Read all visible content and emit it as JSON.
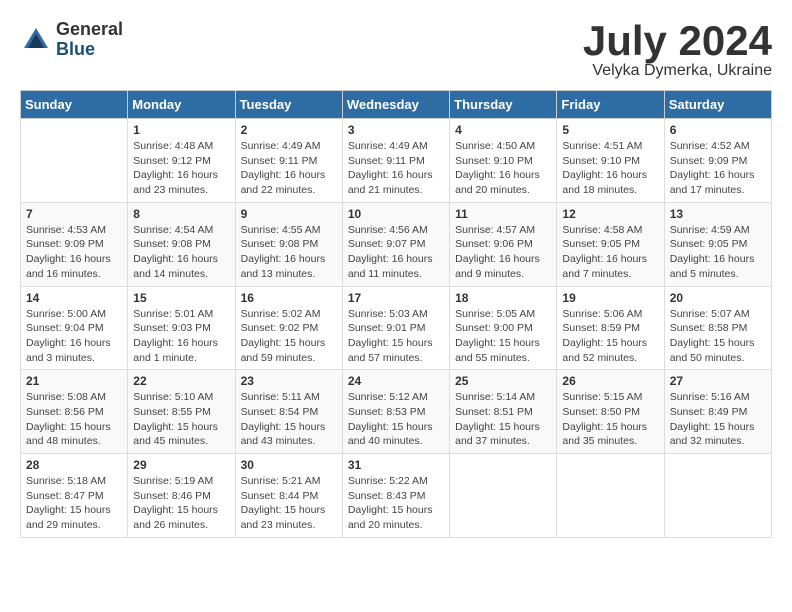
{
  "header": {
    "logo_general": "General",
    "logo_blue": "Blue",
    "title": "July 2024",
    "location": "Velyka Dymerka, Ukraine"
  },
  "columns": [
    "Sunday",
    "Monday",
    "Tuesday",
    "Wednesday",
    "Thursday",
    "Friday",
    "Saturday"
  ],
  "weeks": [
    [
      {
        "day": "",
        "info": ""
      },
      {
        "day": "1",
        "info": "Sunrise: 4:48 AM\nSunset: 9:12 PM\nDaylight: 16 hours\nand 23 minutes."
      },
      {
        "day": "2",
        "info": "Sunrise: 4:49 AM\nSunset: 9:11 PM\nDaylight: 16 hours\nand 22 minutes."
      },
      {
        "day": "3",
        "info": "Sunrise: 4:49 AM\nSunset: 9:11 PM\nDaylight: 16 hours\nand 21 minutes."
      },
      {
        "day": "4",
        "info": "Sunrise: 4:50 AM\nSunset: 9:10 PM\nDaylight: 16 hours\nand 20 minutes."
      },
      {
        "day": "5",
        "info": "Sunrise: 4:51 AM\nSunset: 9:10 PM\nDaylight: 16 hours\nand 18 minutes."
      },
      {
        "day": "6",
        "info": "Sunrise: 4:52 AM\nSunset: 9:09 PM\nDaylight: 16 hours\nand 17 minutes."
      }
    ],
    [
      {
        "day": "7",
        "info": "Sunrise: 4:53 AM\nSunset: 9:09 PM\nDaylight: 16 hours\nand 16 minutes."
      },
      {
        "day": "8",
        "info": "Sunrise: 4:54 AM\nSunset: 9:08 PM\nDaylight: 16 hours\nand 14 minutes."
      },
      {
        "day": "9",
        "info": "Sunrise: 4:55 AM\nSunset: 9:08 PM\nDaylight: 16 hours\nand 13 minutes."
      },
      {
        "day": "10",
        "info": "Sunrise: 4:56 AM\nSunset: 9:07 PM\nDaylight: 16 hours\nand 11 minutes."
      },
      {
        "day": "11",
        "info": "Sunrise: 4:57 AM\nSunset: 9:06 PM\nDaylight: 16 hours\nand 9 minutes."
      },
      {
        "day": "12",
        "info": "Sunrise: 4:58 AM\nSunset: 9:05 PM\nDaylight: 16 hours\nand 7 minutes."
      },
      {
        "day": "13",
        "info": "Sunrise: 4:59 AM\nSunset: 9:05 PM\nDaylight: 16 hours\nand 5 minutes."
      }
    ],
    [
      {
        "day": "14",
        "info": "Sunrise: 5:00 AM\nSunset: 9:04 PM\nDaylight: 16 hours\nand 3 minutes."
      },
      {
        "day": "15",
        "info": "Sunrise: 5:01 AM\nSunset: 9:03 PM\nDaylight: 16 hours\nand 1 minute."
      },
      {
        "day": "16",
        "info": "Sunrise: 5:02 AM\nSunset: 9:02 PM\nDaylight: 15 hours\nand 59 minutes."
      },
      {
        "day": "17",
        "info": "Sunrise: 5:03 AM\nSunset: 9:01 PM\nDaylight: 15 hours\nand 57 minutes."
      },
      {
        "day": "18",
        "info": "Sunrise: 5:05 AM\nSunset: 9:00 PM\nDaylight: 15 hours\nand 55 minutes."
      },
      {
        "day": "19",
        "info": "Sunrise: 5:06 AM\nSunset: 8:59 PM\nDaylight: 15 hours\nand 52 minutes."
      },
      {
        "day": "20",
        "info": "Sunrise: 5:07 AM\nSunset: 8:58 PM\nDaylight: 15 hours\nand 50 minutes."
      }
    ],
    [
      {
        "day": "21",
        "info": "Sunrise: 5:08 AM\nSunset: 8:56 PM\nDaylight: 15 hours\nand 48 minutes."
      },
      {
        "day": "22",
        "info": "Sunrise: 5:10 AM\nSunset: 8:55 PM\nDaylight: 15 hours\nand 45 minutes."
      },
      {
        "day": "23",
        "info": "Sunrise: 5:11 AM\nSunset: 8:54 PM\nDaylight: 15 hours\nand 43 minutes."
      },
      {
        "day": "24",
        "info": "Sunrise: 5:12 AM\nSunset: 8:53 PM\nDaylight: 15 hours\nand 40 minutes."
      },
      {
        "day": "25",
        "info": "Sunrise: 5:14 AM\nSunset: 8:51 PM\nDaylight: 15 hours\nand 37 minutes."
      },
      {
        "day": "26",
        "info": "Sunrise: 5:15 AM\nSunset: 8:50 PM\nDaylight: 15 hours\nand 35 minutes."
      },
      {
        "day": "27",
        "info": "Sunrise: 5:16 AM\nSunset: 8:49 PM\nDaylight: 15 hours\nand 32 minutes."
      }
    ],
    [
      {
        "day": "28",
        "info": "Sunrise: 5:18 AM\nSunset: 8:47 PM\nDaylight: 15 hours\nand 29 minutes."
      },
      {
        "day": "29",
        "info": "Sunrise: 5:19 AM\nSunset: 8:46 PM\nDaylight: 15 hours\nand 26 minutes."
      },
      {
        "day": "30",
        "info": "Sunrise: 5:21 AM\nSunset: 8:44 PM\nDaylight: 15 hours\nand 23 minutes."
      },
      {
        "day": "31",
        "info": "Sunrise: 5:22 AM\nSunset: 8:43 PM\nDaylight: 15 hours\nand 20 minutes."
      },
      {
        "day": "",
        "info": ""
      },
      {
        "day": "",
        "info": ""
      },
      {
        "day": "",
        "info": ""
      }
    ]
  ]
}
